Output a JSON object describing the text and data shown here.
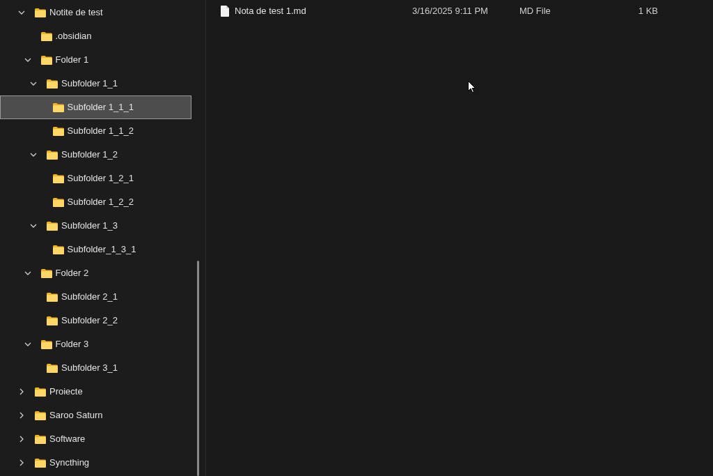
{
  "tree": [
    {
      "label": "Notite de test",
      "expanded": true,
      "selected": false,
      "children": [
        {
          "label": ".obsidian",
          "selected": false
        },
        {
          "label": "Folder 1",
          "expanded": true,
          "selected": false,
          "children": [
            {
              "label": "Subfolder 1_1",
              "expanded": true,
              "selected": false,
              "children": [
                {
                  "label": "Subfolder 1_1_1",
                  "selected": true
                },
                {
                  "label": "Subfolder 1_1_2",
                  "selected": false
                }
              ]
            },
            {
              "label": "Subfolder 1_2",
              "expanded": true,
              "selected": false,
              "children": [
                {
                  "label": "Subfolder 1_2_1",
                  "selected": false
                },
                {
                  "label": "Subfolder 1_2_2",
                  "selected": false
                }
              ]
            },
            {
              "label": "Subfolder 1_3",
              "expanded": true,
              "selected": false,
              "children": [
                {
                  "label": "Subfolder_1_3_1",
                  "selected": false
                }
              ]
            }
          ]
        },
        {
          "label": "Folder 2",
          "expanded": true,
          "selected": false,
          "children": [
            {
              "label": "Subfolder 2_1",
              "selected": false
            },
            {
              "label": "Subfolder 2_2",
              "selected": false
            }
          ]
        },
        {
          "label": "Folder 3",
          "expanded": true,
          "selected": false,
          "children": [
            {
              "label": "Subfolder 3_1",
              "selected": false
            }
          ]
        }
      ]
    },
    {
      "label": "Proiecte",
      "expanded": false,
      "selected": false
    },
    {
      "label": "Saroo Saturn",
      "expanded": false,
      "selected": false
    },
    {
      "label": "Software",
      "expanded": false,
      "selected": false
    },
    {
      "label": "Syncthing",
      "expanded": false,
      "selected": false
    }
  ],
  "files": [
    {
      "name": "Nota de test 1.md",
      "date": "3/16/2025 9:11 PM",
      "type": "MD File",
      "size": "1 KB"
    }
  ]
}
